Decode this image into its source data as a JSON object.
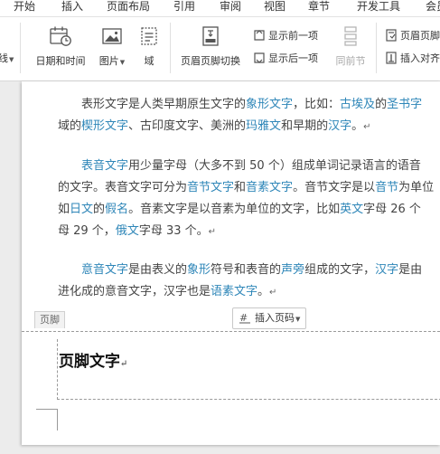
{
  "menubar": {
    "items": [
      "开始",
      "插入",
      "页面布局",
      "引用",
      "审阅",
      "视图",
      "章节",
      "开发工具",
      "会员"
    ]
  },
  "ribbon": {
    "partial_left_label": "线",
    "datetime_label": "日期和时间",
    "picture_label": "图片",
    "field_label": "域",
    "header_footer_switch_label": "页眉页脚切换",
    "show_prev_label": "显示前一项",
    "show_next_label": "显示后一项",
    "same_as_prev_label": "同前节",
    "header_footer_options_label": "页眉页脚",
    "insert_align_tab_label": "插入对齐"
  },
  "document": {
    "paragraphs": [
      {
        "lines": [
          [
            {
              "t": "表形文字是人类早期原生文字的"
            },
            {
              "t": "象形文字",
              "link": true
            },
            {
              "t": "，比如："
            },
            {
              "t": "古埃及",
              "link": true
            },
            {
              "t": "的"
            },
            {
              "t": "圣书字",
              "link": true
            }
          ],
          [
            {
              "t": "域的"
            },
            {
              "t": "楔形文字",
              "link": true
            },
            {
              "t": "、古印度文字、美洲的"
            },
            {
              "t": "玛雅文",
              "link": true
            },
            {
              "t": "和早期的"
            },
            {
              "t": "汉字",
              "link": true
            },
            {
              "t": "。"
            },
            {
              "t": "↵",
              "mark": true
            }
          ]
        ]
      },
      {
        "lines": [
          [
            {
              "t": "表音文字",
              "link": true
            },
            {
              "t": "用少量字母（大多不到 50 个）组成单词记录语言的语音"
            }
          ],
          [
            {
              "t": "的文字。表音文字可分为"
            },
            {
              "t": "音节文字",
              "link": true
            },
            {
              "t": "和"
            },
            {
              "t": "音素文字",
              "link": true
            },
            {
              "t": "。音节文字是以"
            },
            {
              "t": "音节",
              "link": true
            },
            {
              "t": "为单位"
            }
          ],
          [
            {
              "t": "如"
            },
            {
              "t": "日文",
              "link": true
            },
            {
              "t": "的"
            },
            {
              "t": "假名",
              "link": true
            },
            {
              "t": "。音素文字是以音素为单位的文字，比如"
            },
            {
              "t": "英文",
              "link": true
            },
            {
              "t": "字母 26 个"
            }
          ],
          [
            {
              "t": "母 29 个，"
            },
            {
              "t": "俄文",
              "link": true
            },
            {
              "t": "字母 33 个。"
            },
            {
              "t": "↵",
              "mark": true
            }
          ]
        ]
      },
      {
        "lines": [
          [
            {
              "t": "意音文字",
              "link": true
            },
            {
              "t": "是由表义的"
            },
            {
              "t": "象形",
              "link": true
            },
            {
              "t": "符号和表音的"
            },
            {
              "t": "声旁",
              "link": true
            },
            {
              "t": "组成的文字，"
            },
            {
              "t": "汉字",
              "link": true
            },
            {
              "t": "是由"
            }
          ],
          [
            {
              "t": "进化成的意音文字，汉字也是"
            },
            {
              "t": "语素文字",
              "link": true
            },
            {
              "t": "。"
            },
            {
              "t": "↵",
              "mark": true
            }
          ]
        ]
      }
    ]
  },
  "footer": {
    "tag_label": "页脚",
    "insert_page_number_label": "插入页码",
    "content_text": "页脚文字",
    "paragraph_mark": "↵"
  }
}
